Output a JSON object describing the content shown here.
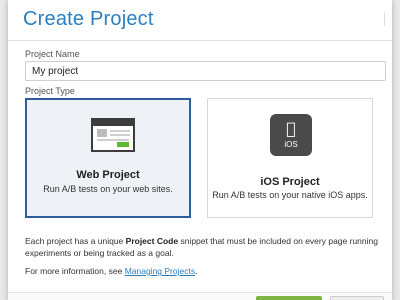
{
  "dialog": {
    "title": "Create Project"
  },
  "form": {
    "name_label": "Project Name",
    "name_value": "My project",
    "type_label": "Project Type"
  },
  "project_types": [
    {
      "title": "Web Project",
      "description": "Run A/B tests on your web sites.",
      "selected": true,
      "icon": "browser-window-icon"
    },
    {
      "title": "iOS Project",
      "description": "Run A/B tests on your native iOS apps.",
      "selected": false,
      "icon": "ios-app-icon",
      "icon_text": "iOS"
    }
  ],
  "info": {
    "line1_prefix": "Each project has a unique ",
    "line1_strong": "Project Code",
    "line1_suffix": " snippet that must be included on every page running experiments or being tracked as a goal.",
    "line2_prefix": "For more information, see ",
    "line2_link": "Managing Projects",
    "line2_suffix": "."
  },
  "colors": {
    "title": "#2a7fc0",
    "selected_border": "#2d5d9a",
    "accent_green": "#5bb832"
  }
}
